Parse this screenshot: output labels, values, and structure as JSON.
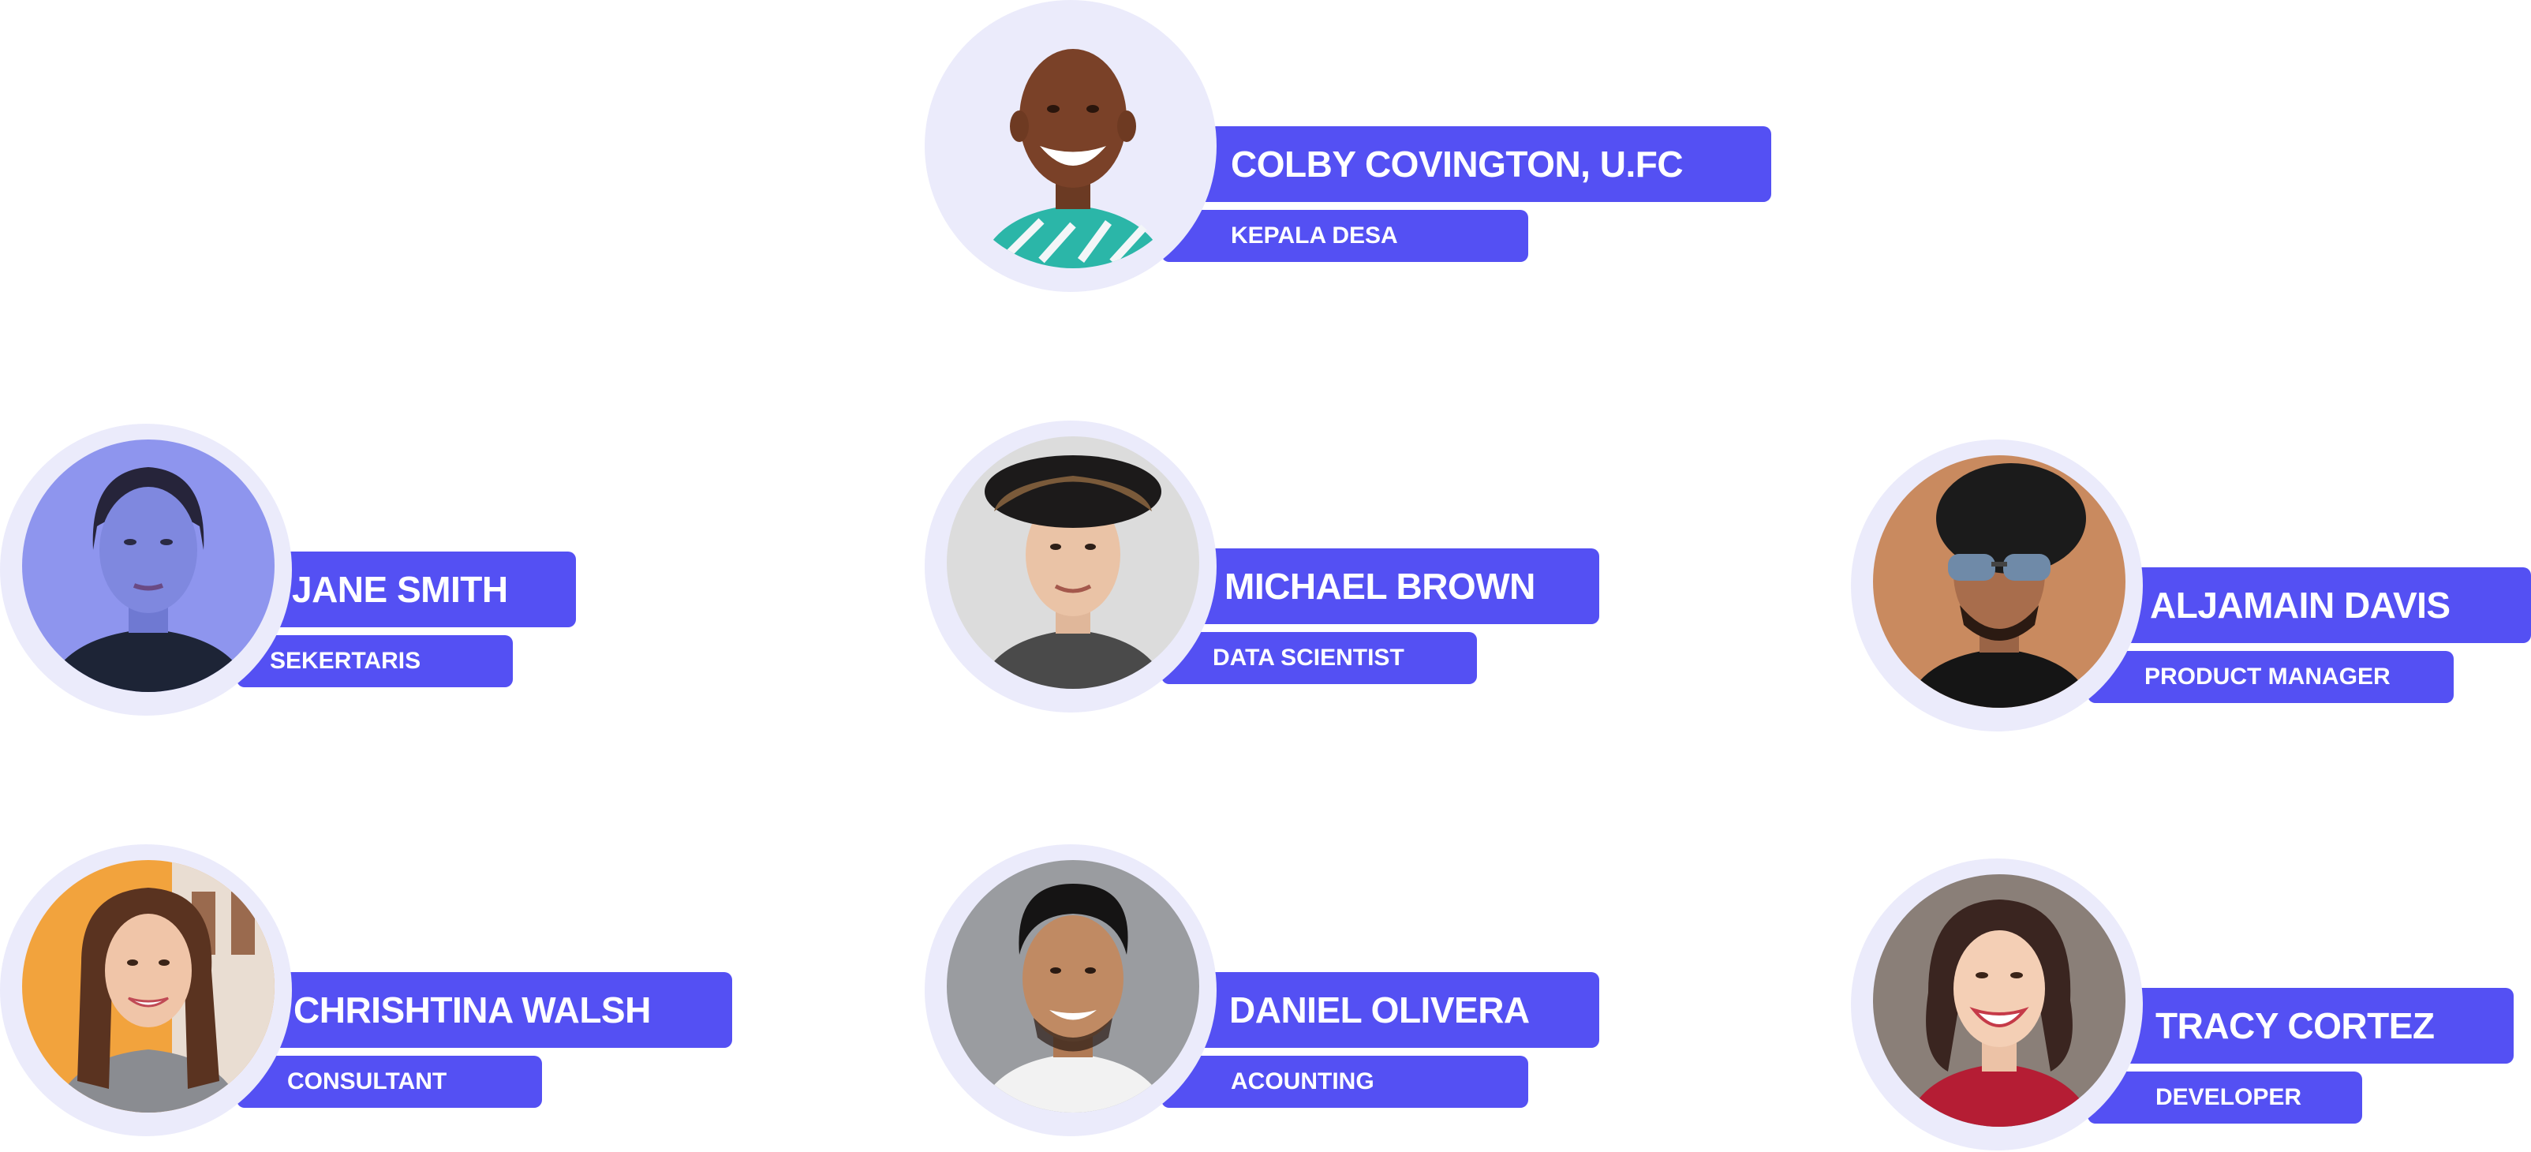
{
  "colors": {
    "accent": "#5450f3",
    "ring": "#ebebfb",
    "label_text": "#ffffff"
  },
  "members": [
    {
      "name": "COLBY COVINGTON, U.FC",
      "role": "KEPALA DESA"
    },
    {
      "name": "JANE SMITH",
      "role": "SEKERTARIS"
    },
    {
      "name": "MICHAEL BROWN",
      "role": "DATA SCIENTIST"
    },
    {
      "name": "ALJAMAIN DAVIS",
      "role": "PRODUCT MANAGER"
    },
    {
      "name": "CHRISHTINA WALSH",
      "role": "CONSULTANT"
    },
    {
      "name": "DANIEL OLIVERA",
      "role": "ACOUNTING"
    },
    {
      "name": "TRACY CORTEZ",
      "role": "DEVELOPER"
    }
  ]
}
